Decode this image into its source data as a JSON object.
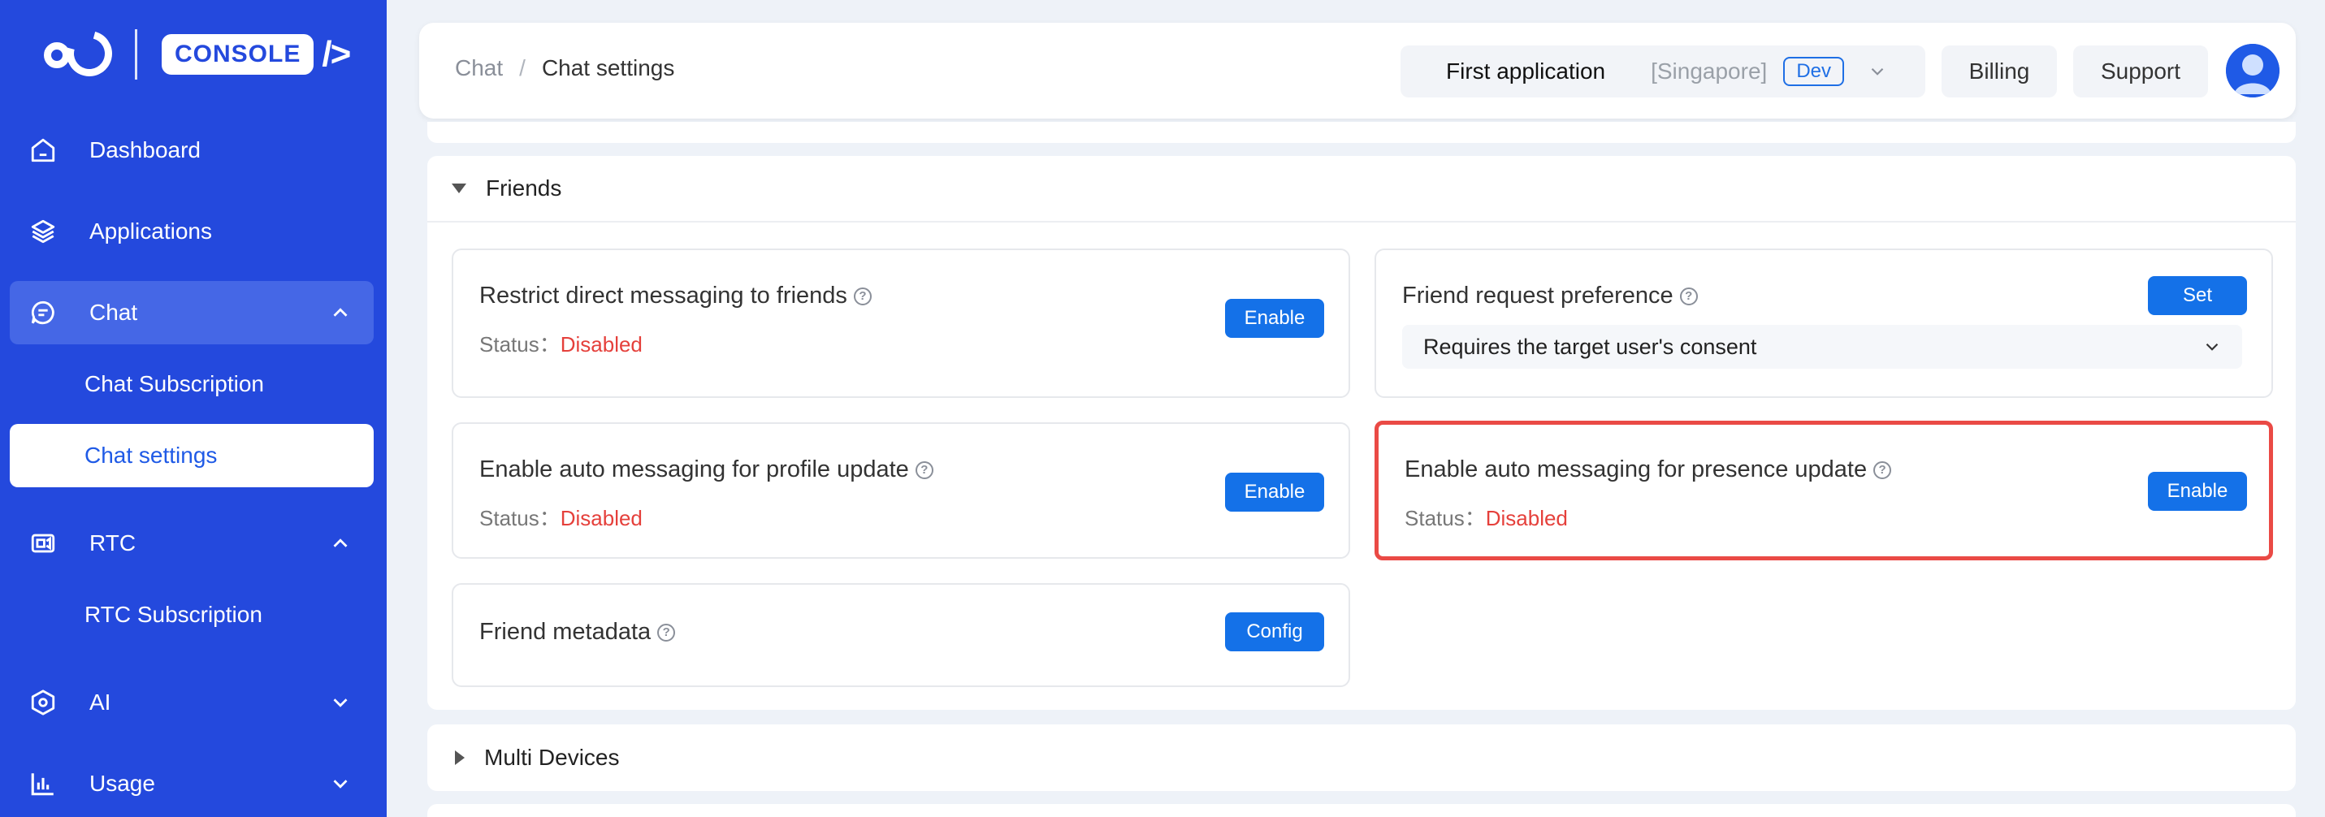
{
  "sidebar": {
    "logo_text": "CONSOLE",
    "logo_slash": "/>",
    "items": [
      {
        "label": "Dashboard"
      },
      {
        "label": "Applications"
      },
      {
        "label": "Chat"
      },
      {
        "label": "RTC"
      },
      {
        "label": "AI"
      },
      {
        "label": "Usage"
      }
    ],
    "chat_sub": [
      {
        "label": "Chat Subscription"
      },
      {
        "label": "Chat settings"
      }
    ],
    "rtc_sub": [
      {
        "label": "RTC Subscription"
      }
    ]
  },
  "header": {
    "breadcrumb": [
      "Chat",
      "/",
      "Chat settings"
    ],
    "app_name": "First application",
    "app_region": "[Singapore]",
    "app_env": "Dev",
    "billing": "Billing",
    "support": "Support"
  },
  "friends": {
    "title": "Friends",
    "cards": [
      {
        "title": "Restrict direct messaging to friends",
        "status_label": "Status：",
        "status_value": "Disabled",
        "button": "Enable"
      },
      {
        "title": "Friend request preference",
        "button": "Set",
        "select_value": "Requires the target user's consent"
      },
      {
        "title": "Enable auto messaging for profile update",
        "status_label": "Status：",
        "status_value": "Disabled",
        "button": "Enable"
      },
      {
        "title": "Enable auto messaging for presence update",
        "status_label": "Status：",
        "status_value": "Disabled",
        "button": "Enable"
      },
      {
        "title": "Friend metadata",
        "button": "Config"
      }
    ]
  },
  "multi_devices": {
    "title": "Multi Devices"
  },
  "colors": {
    "sidebar": "#2449dd",
    "primary_button": "#1471e8",
    "disabled_status": "#e5403b",
    "highlight_border": "#ea4a45"
  }
}
